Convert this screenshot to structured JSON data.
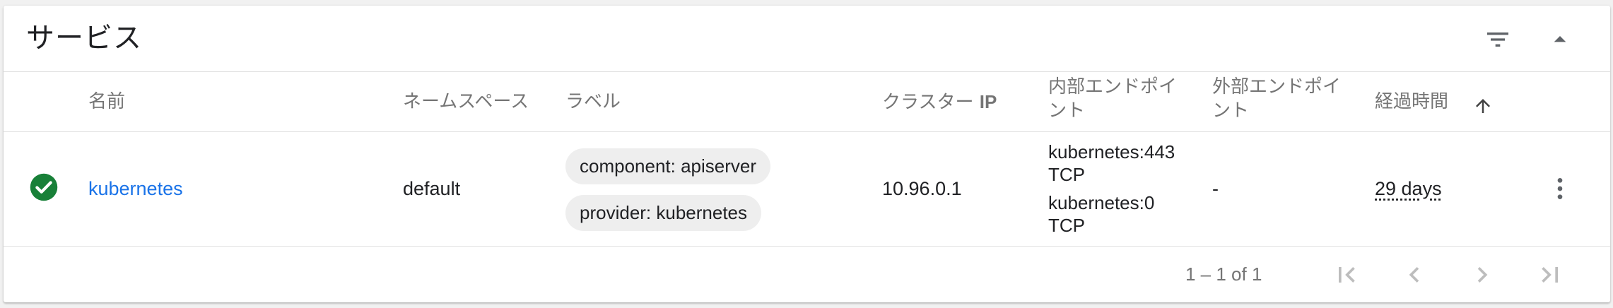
{
  "card": {
    "title": "サービス",
    "filter_icon": "filter-list-icon",
    "collapse_icon": "arrow-drop-up-icon"
  },
  "columns": {
    "name": "名前",
    "namespace": "ネームスペース",
    "labels": "ラベル",
    "cluster_ip_prefix": "クラスター ",
    "cluster_ip_suffix": "IP",
    "internal_endpoints_l1": "内部エンドポイ",
    "internal_endpoints_l2": "ント",
    "external_endpoints_l1": "外部エンドポイ",
    "external_endpoints_l2": "ント",
    "age": "経過時間",
    "age_sort_icon": "arrow-upward-icon"
  },
  "rows": [
    {
      "status_icon": "check-circle-icon",
      "name": "kubernetes",
      "namespace": "default",
      "labels": [
        "component: apiserver",
        "provider: kubernetes"
      ],
      "cluster_ip": "10.96.0.1",
      "internal_endpoints": [
        {
          "host": "kubernetes:443",
          "protocol": "TCP"
        },
        {
          "host": "kubernetes:0",
          "protocol": "TCP"
        }
      ],
      "external_endpoints": "-",
      "age": "29 days",
      "menu_icon": "more-vert-icon"
    }
  ],
  "pagination": {
    "range": "1 – 1 of 1",
    "first_icon": "first-page-icon",
    "prev_icon": "chevron-left-icon",
    "next_icon": "chevron-right-icon",
    "last_icon": "last-page-icon"
  },
  "colors": {
    "accent_link": "#1a73e8",
    "status_ok": "#188038",
    "chip_bg": "#eeeeee",
    "muted_text": "#757575"
  }
}
